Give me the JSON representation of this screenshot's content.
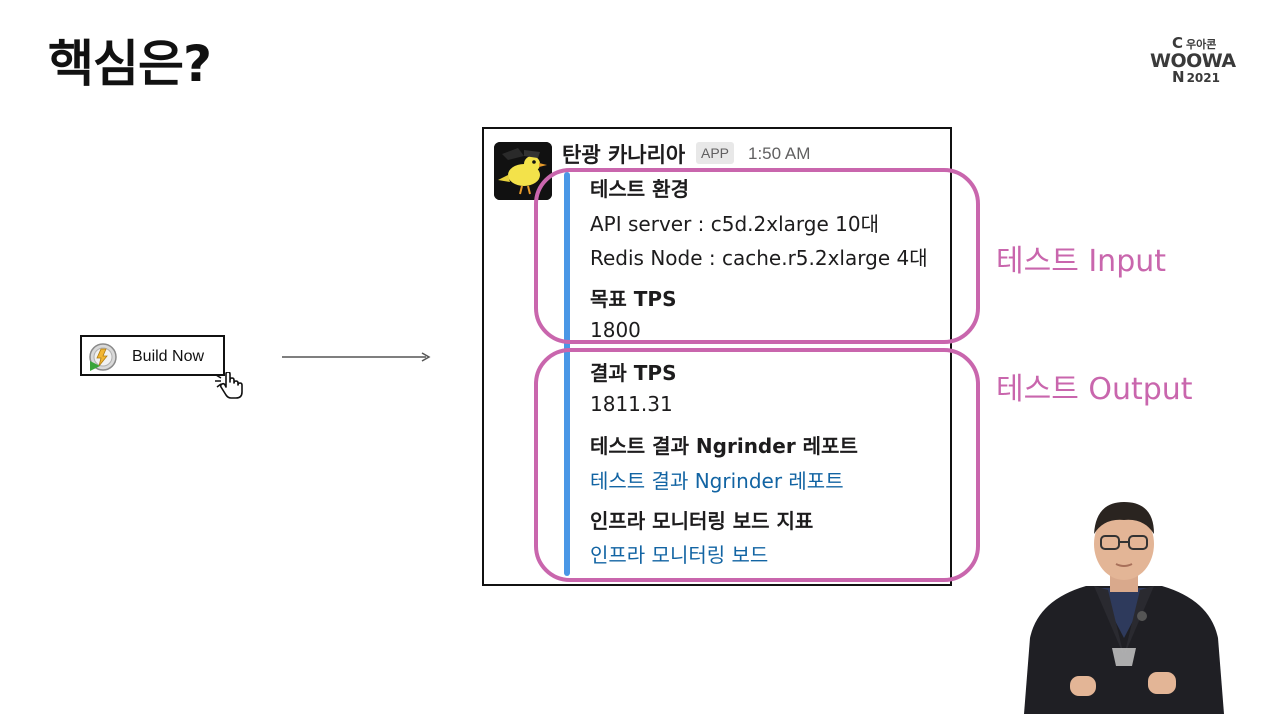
{
  "slide": {
    "title": "핵심은?"
  },
  "logo": {
    "line1_big": "C",
    "line1_small": "우아콘",
    "line2": "WOOWA",
    "line3_big": "N",
    "line3_small": "2021"
  },
  "jenkins": {
    "button_label": "Build Now",
    "icon_name": "jenkins-build-icon",
    "cursor_icon": "hand-pointer-icon"
  },
  "slack_message": {
    "bot_name": "탄광 카나리아",
    "badge": "APP",
    "time": "1:50 AM",
    "avatar_icon": "canary-bird-avatar-icon",
    "bar_color": "#4a97e6",
    "fields": [
      {
        "title": "테스트 환경",
        "values": [
          "API server : c5d.2xlarge 10대",
          "Redis Node : cache.r5.2xlarge 4대"
        ]
      },
      {
        "title": "목표 TPS",
        "values": [
          "1800"
        ]
      },
      {
        "title": "결과 TPS",
        "values": [
          "1811.31"
        ]
      },
      {
        "title": "테스트 결과 Ngrinder 레포트",
        "link": "테스트 결과 Ngrinder 레포트"
      },
      {
        "title": "인프라 모니터링 보드 지표",
        "link": "인프라 모니터링 보드"
      }
    ]
  },
  "annotations": {
    "input_label": "테스트 Input",
    "output_label": "테스트 Output",
    "color": "#c966ad"
  }
}
